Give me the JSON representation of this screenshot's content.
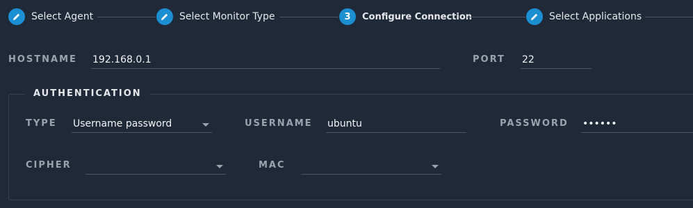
{
  "stepper": {
    "steps": [
      {
        "label": "Select Agent",
        "number": "",
        "icon": "pencil-icon",
        "active": false
      },
      {
        "label": "Select Monitor Type",
        "number": "",
        "icon": "pencil-icon",
        "active": false
      },
      {
        "label": "Configure Connection",
        "number": "3",
        "icon": "",
        "active": true
      },
      {
        "label": "Select Applications",
        "number": "",
        "icon": "pencil-icon",
        "active": false
      }
    ]
  },
  "connection": {
    "hostname_label": "HOSTNAME",
    "hostname_value": "192.168.0.1",
    "port_label": "PORT",
    "port_value": "22"
  },
  "authentication": {
    "legend": "AUTHENTICATION",
    "type_label": "TYPE",
    "type_value": "Username password",
    "username_label": "USERNAME",
    "username_value": "ubuntu",
    "password_label": "PASSWORD",
    "password_value": "••••••",
    "cipher_label": "CIPHER",
    "cipher_value": "",
    "mac_label": "MAC",
    "mac_value": ""
  },
  "colors": {
    "background": "#1f2937",
    "accent": "#1b8fd1",
    "label": "#9ca3af",
    "underline": "#4b5563"
  }
}
